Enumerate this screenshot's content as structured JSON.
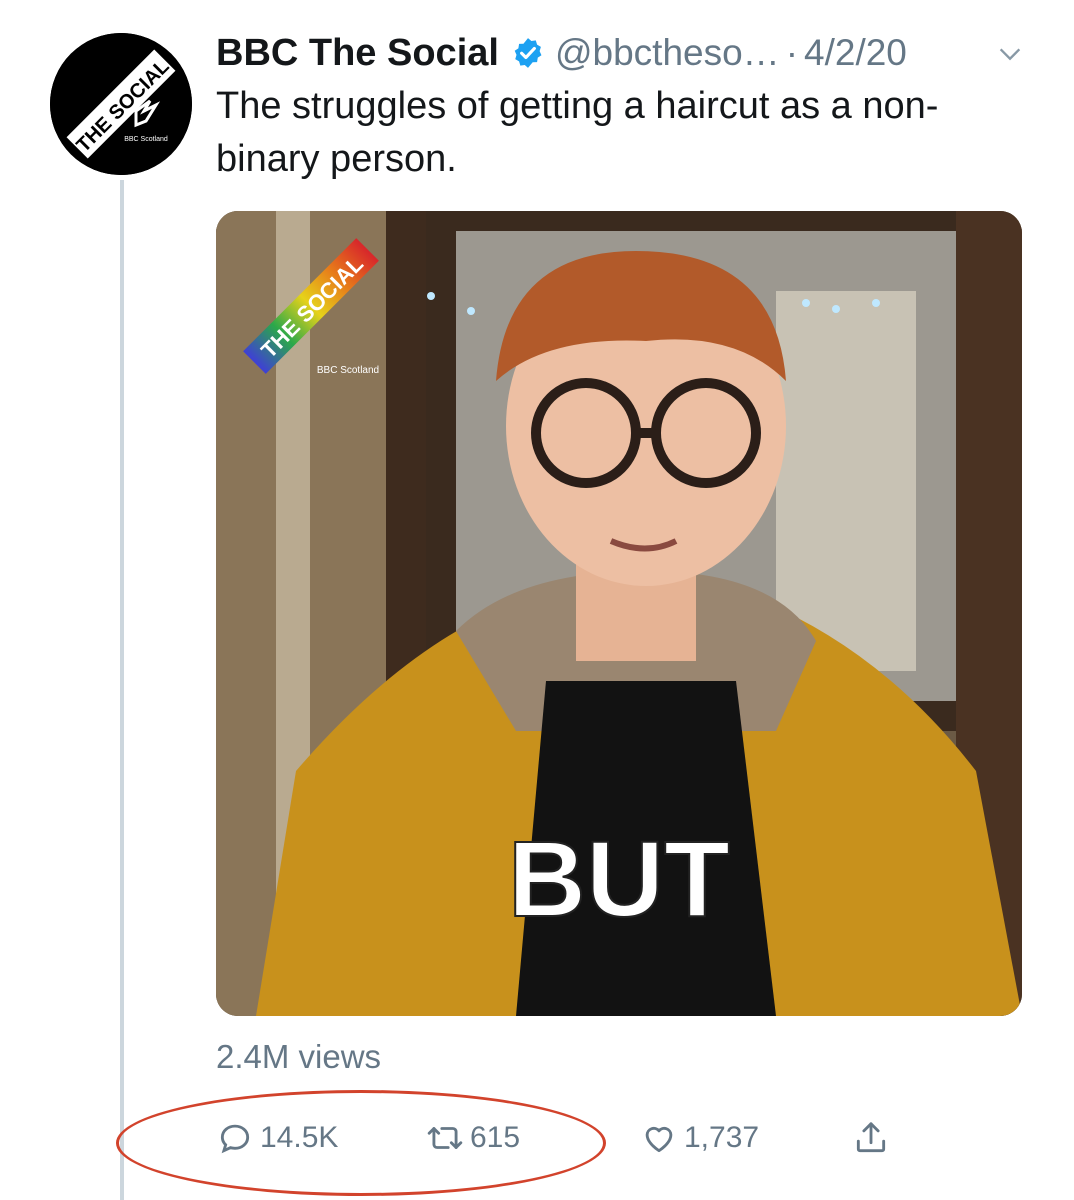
{
  "tweet": {
    "display_name": "BBC The Social",
    "handle": "@bbctheso…",
    "separator": "·",
    "date": "4/2/20",
    "text": "The struggles of getting a haircut as a non-binary person.",
    "verified": true,
    "avatar": {
      "logo_text": "THE SOCIAL",
      "sub_text": "BBC Scotland"
    },
    "media": {
      "caption": "BUT",
      "watermark": "THE SOCIAL",
      "watermark_sub": "BBC Scotland"
    },
    "views": "2.4M views",
    "actions": {
      "reply_count": "14.5K",
      "retweet_count": "615",
      "like_count": "1,737"
    }
  },
  "icons": {
    "verified": "verified-badge-icon",
    "chevron": "chevron-down-icon",
    "reply": "reply-icon",
    "retweet": "retweet-icon",
    "like": "heart-icon",
    "share": "share-icon"
  },
  "colors": {
    "text": "#14171a",
    "secondary": "#657786",
    "verified": "#1da1f2",
    "thread_line": "#ccd6dd",
    "annotation": "#d2432c"
  }
}
